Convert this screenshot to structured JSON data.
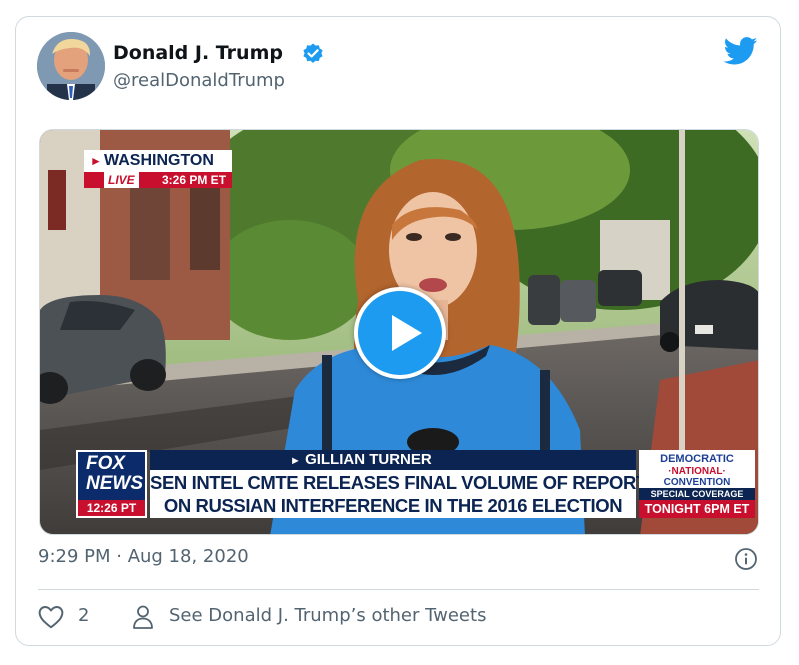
{
  "tweet": {
    "author_name": "Donald J. Trump",
    "handle": "@realDonaldTrump",
    "verified": true,
    "timestamp": "9:29 PM · Aug 18, 2020",
    "like_count": "2",
    "see_other_label": "See Donald J. Trump’s other Tweets"
  },
  "video": {
    "dateline_city": "WASHINGTON",
    "live_label": "LIVE",
    "live_time": "3:26 PM ET",
    "network_word1": "FOX",
    "network_word2": "NEWS",
    "network_time": "12:26 PT",
    "speaker": "GILLIAN TURNER",
    "headline_line1": "SEN INTEL CMTE RELEASES FINAL VOLUME OF REPORT",
    "headline_line2": "ON RUSSIAN INTERFERENCE IN THE 2016 ELECTION",
    "promo_line1": "DEMOCRATIC",
    "promo_line2": "·NATIONAL·",
    "promo_line3": "CONVENTION",
    "promo_sub": "SPECIAL COVERAGE",
    "promo_time": "TONIGHT 6PM ET"
  },
  "icons": {
    "brand": "twitter-bird-icon",
    "verified": "verified-badge-icon",
    "play": "play-icon",
    "info": "info-icon",
    "like": "heart-icon",
    "profile": "person-icon"
  },
  "colors": {
    "twitter_blue": "#1d9bf0",
    "secondary_text": "#536471",
    "border": "#cfd9de",
    "fox_red": "#c8102e",
    "fox_navy": "#0b2451"
  }
}
